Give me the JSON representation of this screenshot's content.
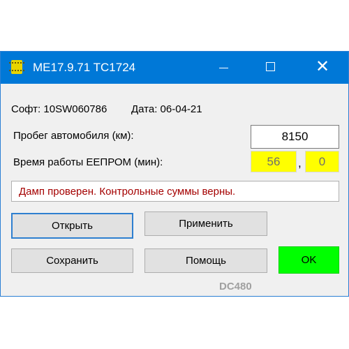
{
  "window": {
    "title": "ME17.9.71 TC1724",
    "icon": "chip-icon",
    "colors": {
      "titlebar": "#0078d7",
      "ok": "#00ff00",
      "counter_bg": "#ffff00",
      "status_text": "#a40000"
    }
  },
  "info": {
    "software": "Софт: 10SW060786",
    "date": "Дата: 06-04-21"
  },
  "mileage": {
    "label": "Пробег автомобиля (км):",
    "value": "8150"
  },
  "eeprom": {
    "label": "Время работы ЕЕПРОМ (мин):",
    "value1": "56",
    "separator": ",",
    "value2": "0"
  },
  "status": {
    "text": "Дамп проверен. Контрольные суммы верны."
  },
  "buttons": {
    "open": "Открыть",
    "apply": "Применить",
    "save": "Сохранить",
    "help": "Помощь",
    "ok": "OK"
  },
  "watermark": "DC480"
}
